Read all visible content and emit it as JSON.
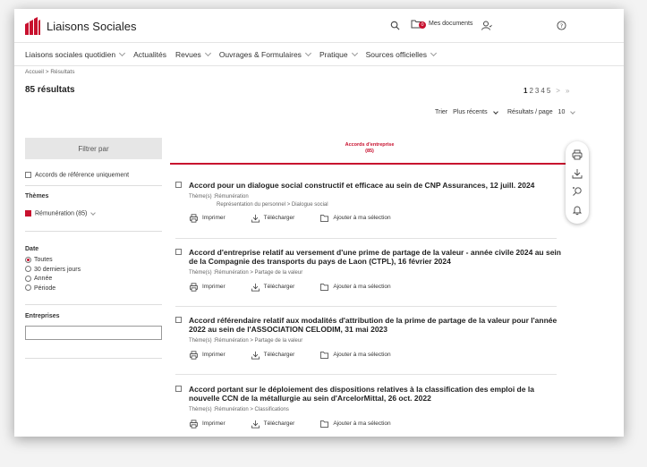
{
  "header": {
    "logo_text": "Liaisons Sociales",
    "documents_label": "Mes documents",
    "documents_badge": "0"
  },
  "nav": [
    {
      "label": "Liaisons sociales quotidien",
      "dropdown": true
    },
    {
      "label": "Actualités",
      "dropdown": false
    },
    {
      "label": "Revues",
      "dropdown": true
    },
    {
      "label": "Ouvrages & Formulaires",
      "dropdown": true
    },
    {
      "label": "Pratique",
      "dropdown": true
    },
    {
      "label": "Sources officielles",
      "dropdown": true
    }
  ],
  "breadcrumb": "Accueil > Résultats",
  "results_count": "85 résultats",
  "pager": {
    "pages": [
      "1",
      "2",
      "3",
      "4",
      "5"
    ],
    "current": "1",
    "next": ">",
    "last": "»"
  },
  "sort": {
    "label": "Trier",
    "value": "Plus récents",
    "per_page_label": "Résultats / page",
    "per_page_value": "10"
  },
  "filters": {
    "button": "Filtrer par",
    "reference_only": "Accords de référence uniquement",
    "themes_heading": "Thèmes",
    "theme_item": "Rémunération (85)",
    "date_heading": "Date",
    "date_options": [
      "Toutes",
      "30 derniers jours",
      "Année",
      "Période"
    ],
    "date_selected": "Toutes",
    "entreprises_heading": "Entreprises"
  },
  "tab": {
    "label": "Accords d'entreprise",
    "count": "(85)"
  },
  "actions": {
    "print": "Imprimer",
    "download": "Télécharger",
    "add": "Ajouter à ma sélection"
  },
  "results": [
    {
      "title": "Accord pour un dialogue social constructif et efficace au sein de CNP Assurances, 12 juill. 2024",
      "theme_line1": "Thème(s) :Rémunération",
      "theme_line2": "Représentation du personnel > Dialogue social"
    },
    {
      "title": "Accord d'entreprise relatif au versement d'une prime de partage de la valeur - année civile 2024 au sein de la Compagnie des transports du pays de Laon (CTPL), 16 février 2024",
      "theme_line1": "Thème(s) :Rémunération > Partage de la valeur",
      "theme_line2": ""
    },
    {
      "title": "Accord référendaire relatif aux modalités d'attribution de la prime de partage de la valeur pour l'année 2022 au sein de l'ASSOCIATION CELODIM, 31 mai 2023",
      "theme_line1": "Thème(s) :Rémunération > Partage de la valeur",
      "theme_line2": ""
    },
    {
      "title": "Accord portant sur le déploiement des dispositions relatives à la classification des emploi de la nouvelle CCN de la métallurgie au sein d'ArcelorMittal, 26 oct. 2022",
      "theme_line1": "Thème(s) :Rémunération > Classifications",
      "theme_line2": ""
    }
  ],
  "colors": {
    "accent": "#c8102e"
  }
}
